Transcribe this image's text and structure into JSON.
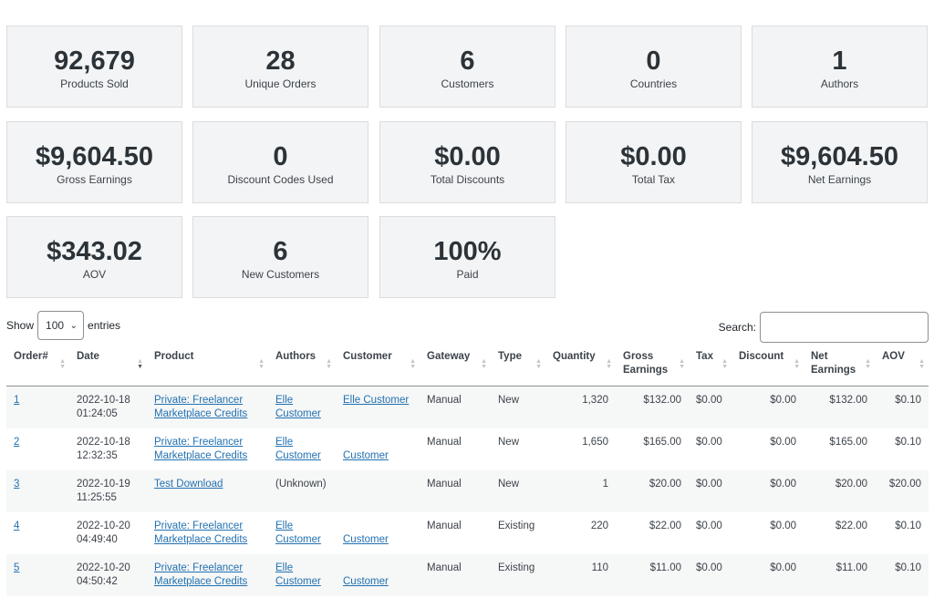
{
  "stats": [
    {
      "value": "92,679",
      "label": "Products Sold"
    },
    {
      "value": "28",
      "label": "Unique Orders"
    },
    {
      "value": "6",
      "label": "Customers"
    },
    {
      "value": "0",
      "label": "Countries"
    },
    {
      "value": "1",
      "label": "Authors"
    },
    {
      "value": "$9,604.50",
      "label": "Gross Earnings"
    },
    {
      "value": "0",
      "label": "Discount Codes Used"
    },
    {
      "value": "$0.00",
      "label": "Total Discounts"
    },
    {
      "value": "$0.00",
      "label": "Total Tax"
    },
    {
      "value": "$9,604.50",
      "label": "Net Earnings"
    },
    {
      "value": "$343.02",
      "label": "AOV"
    },
    {
      "value": "6",
      "label": "New Customers"
    },
    {
      "value": "100%",
      "label": "Paid"
    }
  ],
  "controls": {
    "show_label": "Show",
    "entries_value": "100",
    "entries_label": "entries",
    "search_label": "Search:",
    "search_value": ""
  },
  "table": {
    "headers": {
      "order": "Order#",
      "date": "Date",
      "product": "Product",
      "authors": "Authors",
      "customer": "Customer",
      "gateway": "Gateway",
      "type": "Type",
      "quantity": "Quantity",
      "gross_1": "Gross",
      "gross_2": "Earnings",
      "tax": "Tax",
      "discount": "Discount",
      "net_1": "Net",
      "net_2": "Earnings",
      "aov": "AOV"
    },
    "rows": [
      {
        "order": "1",
        "date_1": "2022-10-18",
        "date_2": "01:24:05",
        "product_1": "Private: Freelancer",
        "product_2": "Marketplace Credits",
        "author_1": "Elle",
        "author_2": "Customer",
        "customer": "Elle Customer",
        "gateway": "Manual",
        "type": "New",
        "quantity": "1,320",
        "gross": "$132.00",
        "tax": "$0.00",
        "discount": "$0.00",
        "net": "$132.00",
        "aov": "$0.10"
      },
      {
        "order": "2",
        "date_1": "2022-10-18",
        "date_2": "12:32:35",
        "product_1": "Private: Freelancer",
        "product_2": "Marketplace Credits",
        "author_1": "Elle",
        "author_2": "Customer",
        "customer": "Customer",
        "gateway": "Manual",
        "type": "New",
        "quantity": "1,650",
        "gross": "$165.00",
        "tax": "$0.00",
        "discount": "$0.00",
        "net": "$165.00",
        "aov": "$0.10"
      },
      {
        "order": "3",
        "date_1": "2022-10-19",
        "date_2": "11:25:55",
        "product_1": "Test Download",
        "product_2": "",
        "author_1": "(Unknown)",
        "author_2": "",
        "customer": "",
        "gateway": "Manual",
        "type": "New",
        "quantity": "1",
        "gross": "$20.00",
        "tax": "$0.00",
        "discount": "$0.00",
        "net": "$20.00",
        "aov": "$20.00"
      },
      {
        "order": "4",
        "date_1": "2022-10-20",
        "date_2": "04:49:40",
        "product_1": "Private: Freelancer",
        "product_2": "Marketplace Credits",
        "author_1": "Elle",
        "author_2": "Customer",
        "customer": "Customer",
        "gateway": "Manual",
        "type": "Existing",
        "quantity": "220",
        "gross": "$22.00",
        "tax": "$0.00",
        "discount": "$0.00",
        "net": "$22.00",
        "aov": "$0.10"
      },
      {
        "order": "5",
        "date_1": "2022-10-20",
        "date_2": "04:50:42",
        "product_1": "Private: Freelancer",
        "product_2": "Marketplace Credits",
        "author_1": "Elle",
        "author_2": "Customer",
        "customer": "Customer",
        "gateway": "Manual",
        "type": "Existing",
        "quantity": "110",
        "gross": "$11.00",
        "tax": "$0.00",
        "discount": "$0.00",
        "net": "$11.00",
        "aov": "$0.10"
      }
    ]
  }
}
